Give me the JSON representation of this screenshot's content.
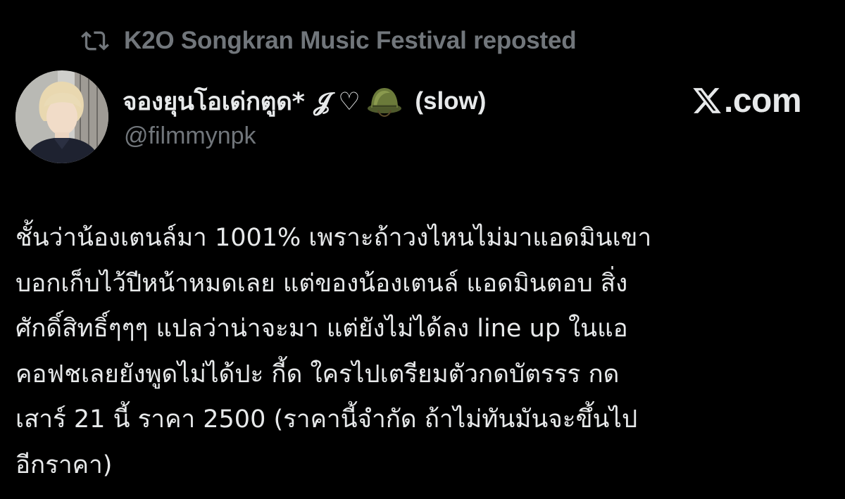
{
  "repost": {
    "icon": "repost-icon",
    "text": "K2O Songkran Music Festival reposted"
  },
  "author": {
    "display_name": "จองยุนโอเด่กตูด* 𝓙 ♡",
    "helmet_icon": "military-helmet-emoji",
    "suffix": "(slow)",
    "handle": "@filmmynpk",
    "avatar": "profile-avatar"
  },
  "watermark": {
    "logo": "x-logo-icon",
    "text": ".com"
  },
  "tweet": {
    "lines": [
      "ชั้นว่าน้องเตนล์มา 1001% เพราะถ้าวงไหนไม่มาแอดมินเขา",
      "บอกเก็บไว้ปีหน้าหมดเลย แต่ของน้องเตนล์ แอดมินตอบ สิ่ง",
      "ศักดิ์สิทธิ์ๆๆๆ แปลว่าน่าจะมา แต่ยังไม่ได้ลง line up ในแอ",
      "คอฟชเลยยังพูดไม่ได้ปะ กี้ด ใครไปเตรียมตัวกดบัตรรร กด",
      "เสาร์ 21 นี้ ราคา 2500 (ราคานี้จำกัด ถ้าไม่ทันมันจะขึ้นไป",
      "อีกราคา)"
    ]
  },
  "colors": {
    "background": "#000000",
    "primary_text": "#e7e9ea",
    "secondary_text": "#71767b"
  }
}
